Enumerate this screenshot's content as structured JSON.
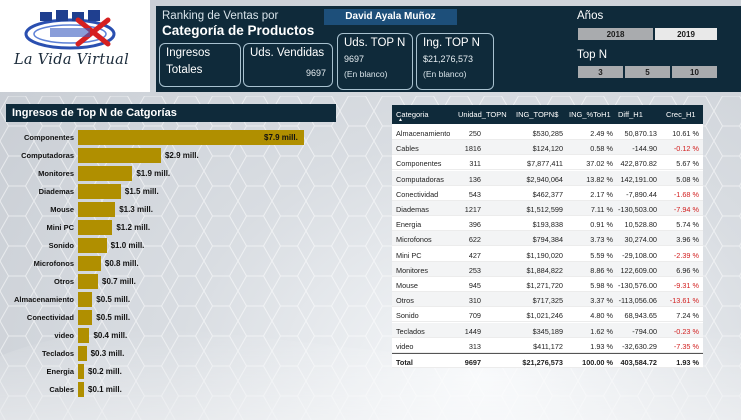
{
  "logo": {
    "text": "La Vida Virtual"
  },
  "header": {
    "title_sub": "Ranking de Ventas por",
    "title_main": "Categoría de Productos",
    "user": "David Ayala Muñoz",
    "cards": {
      "ingresos": {
        "label1": "Ingresos",
        "label2": "Totales"
      },
      "uds_vendidas": {
        "label": "Uds. Vendidas",
        "value": "9697"
      },
      "uds_top_n": {
        "label": "Uds. TOP N",
        "value": "9697",
        "sub": "(En blanco)"
      },
      "ing_top_n": {
        "label": "Ing. TOP N",
        "value": "$21,276,573",
        "sub": "(En blanco)"
      }
    },
    "years": {
      "label": "Años",
      "options": [
        "2018",
        "2019"
      ],
      "selected": "2019"
    },
    "topn": {
      "label": "Top N",
      "options": [
        "3",
        "5",
        "10"
      ]
    }
  },
  "bar_panel": {
    "title": "Ingresos de Top N de Catgorías",
    "chart_data": {
      "type": "bar",
      "orientation": "horizontal",
      "categories": [
        "Componentes",
        "Computadoras",
        "Monitores",
        "Diademas",
        "Mouse",
        "Mini PC",
        "Sonido",
        "Microfonos",
        "Otros",
        "Almacenamiento",
        "Conectividad",
        "video",
        "Teclados",
        "Energia",
        "Cables"
      ],
      "values": [
        7.9,
        2.9,
        1.9,
        1.5,
        1.3,
        1.2,
        1.0,
        0.8,
        0.7,
        0.5,
        0.5,
        0.4,
        0.3,
        0.2,
        0.1
      ],
      "labels": [
        "$7.9 mill.",
        "$2.9 mill.",
        "$1.9 mill.",
        "$1.5 mill.",
        "$1.3 mill.",
        "$1.2 mill.",
        "$1.0 mill.",
        "$0.8 mill.",
        "$0.7 mill.",
        "$0.5 mill.",
        "$0.5 mill.",
        "$0.4 mill.",
        "$0.3 mill.",
        "$0.2 mill.",
        "$0.1 mill."
      ],
      "unit": "mill.",
      "color": "#b08f00"
    }
  },
  "table": {
    "columns": [
      "Categoria",
      "Unidad_TOPN",
      "ING_TOPN$",
      "ING_%ToH1",
      "Diff_H1",
      "Crec_H1"
    ],
    "rows": [
      [
        "Almacenamiento",
        "250",
        "$530,285",
        "2.49 %",
        "50,870.13",
        "10.61 %"
      ],
      [
        "Cables",
        "1816",
        "$124,120",
        "0.58 %",
        "-144.90",
        "-0.12 %"
      ],
      [
        "Componentes",
        "311",
        "$7,877,411",
        "37.02 %",
        "422,870.82",
        "5.67 %"
      ],
      [
        "Computadoras",
        "136",
        "$2,940,064",
        "13.82 %",
        "142,191.00",
        "5.08 %"
      ],
      [
        "Conectividad",
        "543",
        "$462,377",
        "2.17 %",
        "-7,890.44",
        "-1.68 %"
      ],
      [
        "Diademas",
        "1217",
        "$1,512,599",
        "7.11 %",
        "-130,503.00",
        "-7.94 %"
      ],
      [
        "Energia",
        "396",
        "$193,838",
        "0.91 %",
        "10,528.80",
        "5.74 %"
      ],
      [
        "Microfonos",
        "622",
        "$794,384",
        "3.73 %",
        "30,274.00",
        "3.96 %"
      ],
      [
        "Mini PC",
        "427",
        "$1,190,020",
        "5.59 %",
        "-29,108.00",
        "-2.39 %"
      ],
      [
        "Monitores",
        "253",
        "$1,884,822",
        "8.86 %",
        "122,609.00",
        "6.96 %"
      ],
      [
        "Mouse",
        "945",
        "$1,271,720",
        "5.98 %",
        "-130,576.00",
        "-9.31 %"
      ],
      [
        "Otros",
        "310",
        "$717,325",
        "3.37 %",
        "-113,056.06",
        "-13.61 %"
      ],
      [
        "Sonido",
        "709",
        "$1,021,246",
        "4.80 %",
        "68,943.65",
        "7.24 %"
      ],
      [
        "Teclados",
        "1449",
        "$345,189",
        "1.62 %",
        "-794.00",
        "-0.23 %"
      ],
      [
        "video",
        "313",
        "$411,172",
        "1.93 %",
        "-32,630.29",
        "-7.35 %"
      ]
    ],
    "total": [
      "Total",
      "9697",
      "$21,276,573",
      "100.00 %",
      "403,584.72",
      "1.93 %"
    ]
  },
  "colors": {
    "header_bg": "#0f2a3a",
    "bar": "#b08f00",
    "negative": "#d21f1f"
  }
}
